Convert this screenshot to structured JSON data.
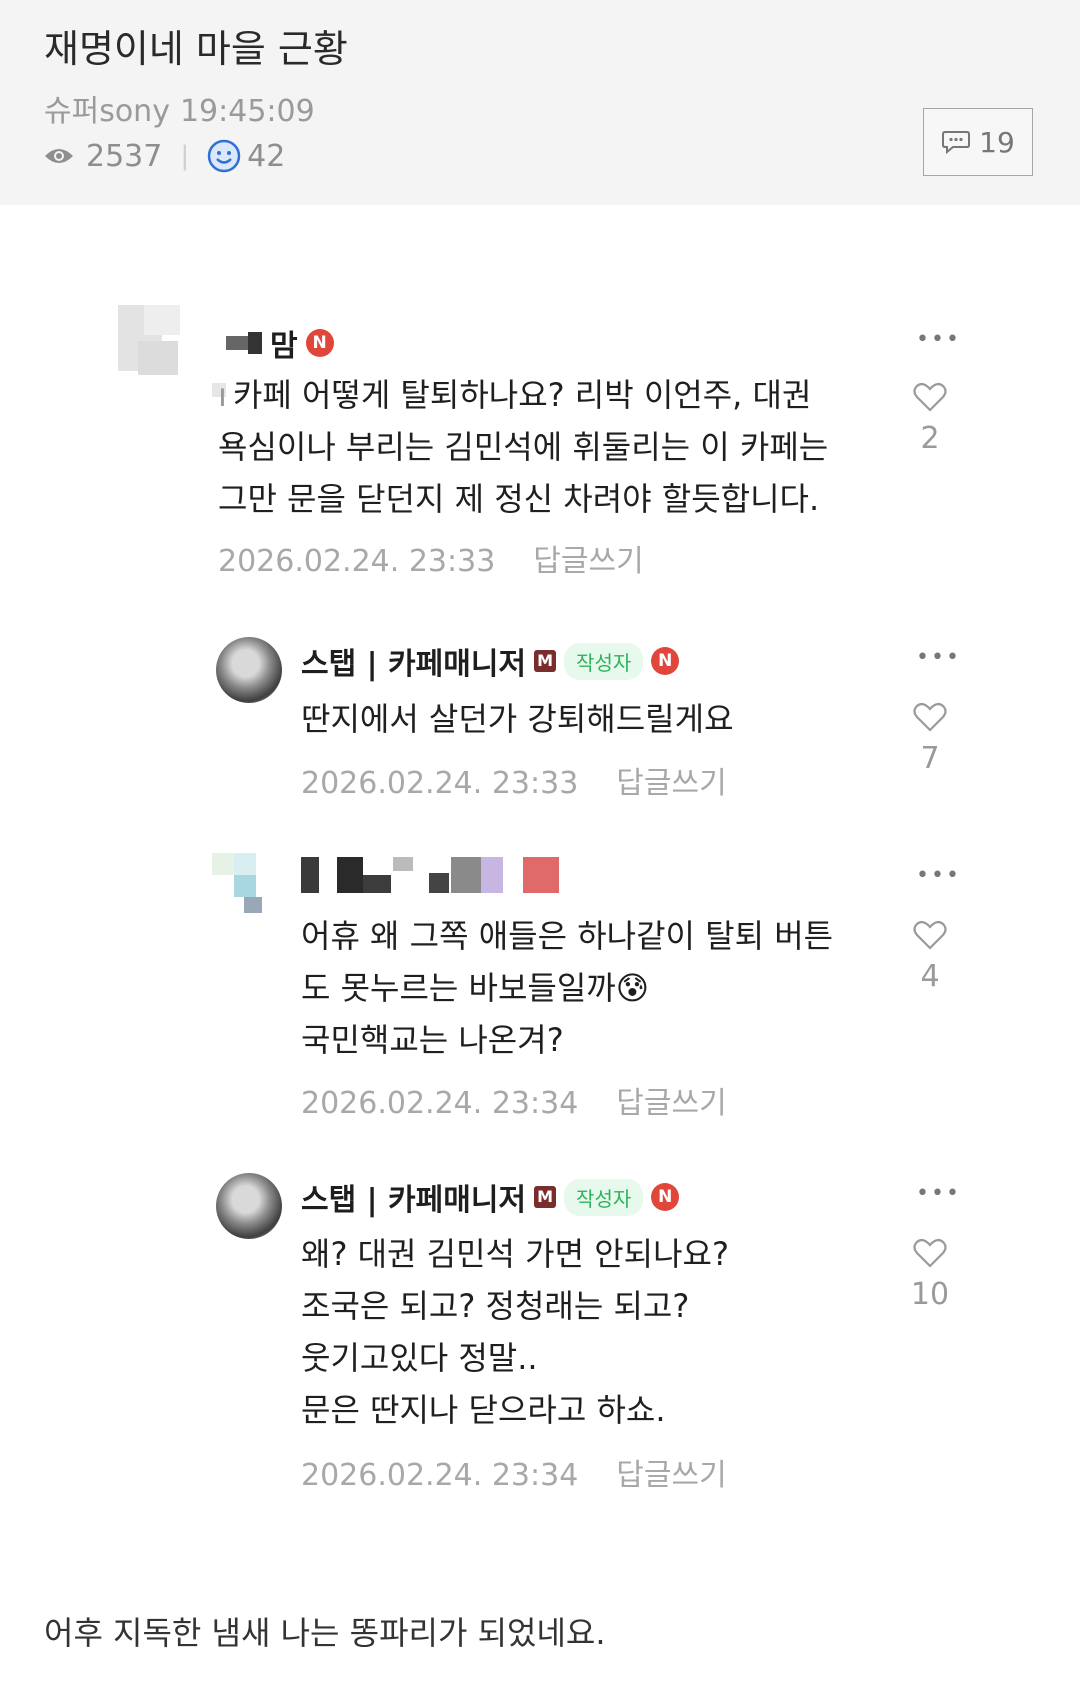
{
  "post": {
    "title": "재명이네 마을 근황",
    "author": "슈퍼sony",
    "time": "19:45:09",
    "views": "2537",
    "likes": "42",
    "comment_count": "19"
  },
  "comments": [
    {
      "name": "맘",
      "body_lines": [
        "카페 어떻게 탈퇴하나요? 리박 이언주, 대권",
        "욕심이나 부리는 김민석에 휘둘리는 이 카페는",
        "그만 문을 닫던지 제 정신 차려야 할듯합니다."
      ],
      "date": "2026.02.24. 23:33",
      "reply": "답글쓰기",
      "like_count": "2",
      "n_badge": "N"
    },
    {
      "name": "스탭 | 카페매니저",
      "m_badge": "M",
      "writer_badge": "작성자",
      "n_badge": "N",
      "body_lines": [
        "딴지에서 살던가 강퇴해드릴게요"
      ],
      "date": "2026.02.24. 23:33",
      "reply": "답글쓰기",
      "like_count": "7"
    },
    {
      "body_lines": [
        "어휴 왜 그쪽 애들은 하나같이 탈퇴 버튼",
        "도 못누르는 바보들일까😰",
        "국민핵교는 나온겨?"
      ],
      "date": "2026.02.24. 23:34",
      "reply": "답글쓰기",
      "like_count": "4"
    },
    {
      "name": "스탭 | 카페매니저",
      "m_badge": "M",
      "writer_badge": "작성자",
      "n_badge": "N",
      "body_lines": [
        "왜? 대권 김민석 가면 안되나요?",
        "조국은 되고? 정청래는 되고?",
        "웃기고있다 정말..",
        "문은 딴지나 닫으라고 하쇼."
      ],
      "date": "2026.02.24. 23:34",
      "reply": "답글쓰기",
      "like_count": "10"
    }
  ],
  "footer": "어후 지독한 냄새 나는 똥파리가 되었네요.",
  "icons": [
    "eye-icon",
    "smile-icon",
    "speech-bubble-icon",
    "heart-icon",
    "more-dots-icon"
  ],
  "colors": {
    "header_bg": "#f4f4f4",
    "n_badge": "#e0473a",
    "writer_badge_text": "#2fb45e",
    "smile_icon": "#2f6fd6"
  }
}
